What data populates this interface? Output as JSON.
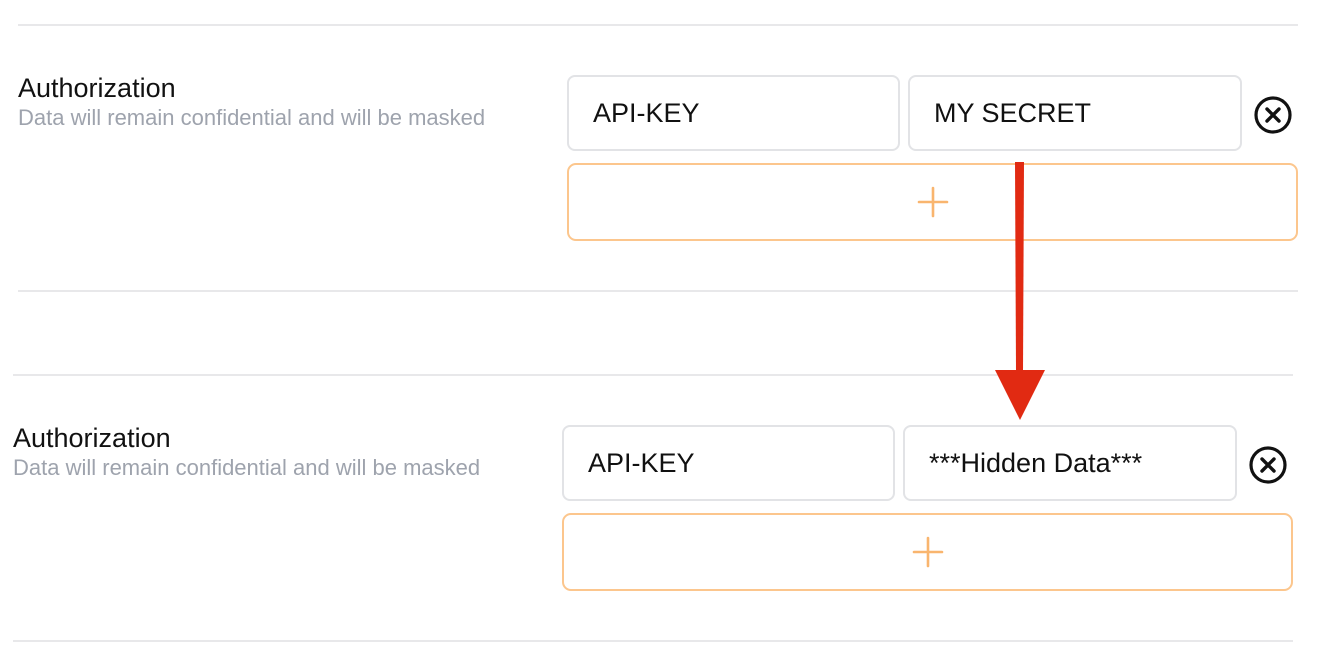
{
  "rows": [
    {
      "title": "Authorization",
      "description": "Data will remain confidential and will be masked",
      "key_value": "API-KEY",
      "secret_value": "MY SECRET"
    },
    {
      "title": "Authorization",
      "description": "Data will remain confidential and will be masked",
      "key_value": "API-KEY",
      "secret_value": "***Hidden Data***"
    }
  ],
  "icons": {
    "remove": "x-circle-icon",
    "add": "plus-icon",
    "transition": "arrow-down-icon"
  },
  "colors": {
    "add_border": "#fcc68d",
    "plus": "#f9b56e",
    "arrow": "#e12a12",
    "muted_text": "#9ea3ad",
    "divider": "#e8e8ea"
  }
}
